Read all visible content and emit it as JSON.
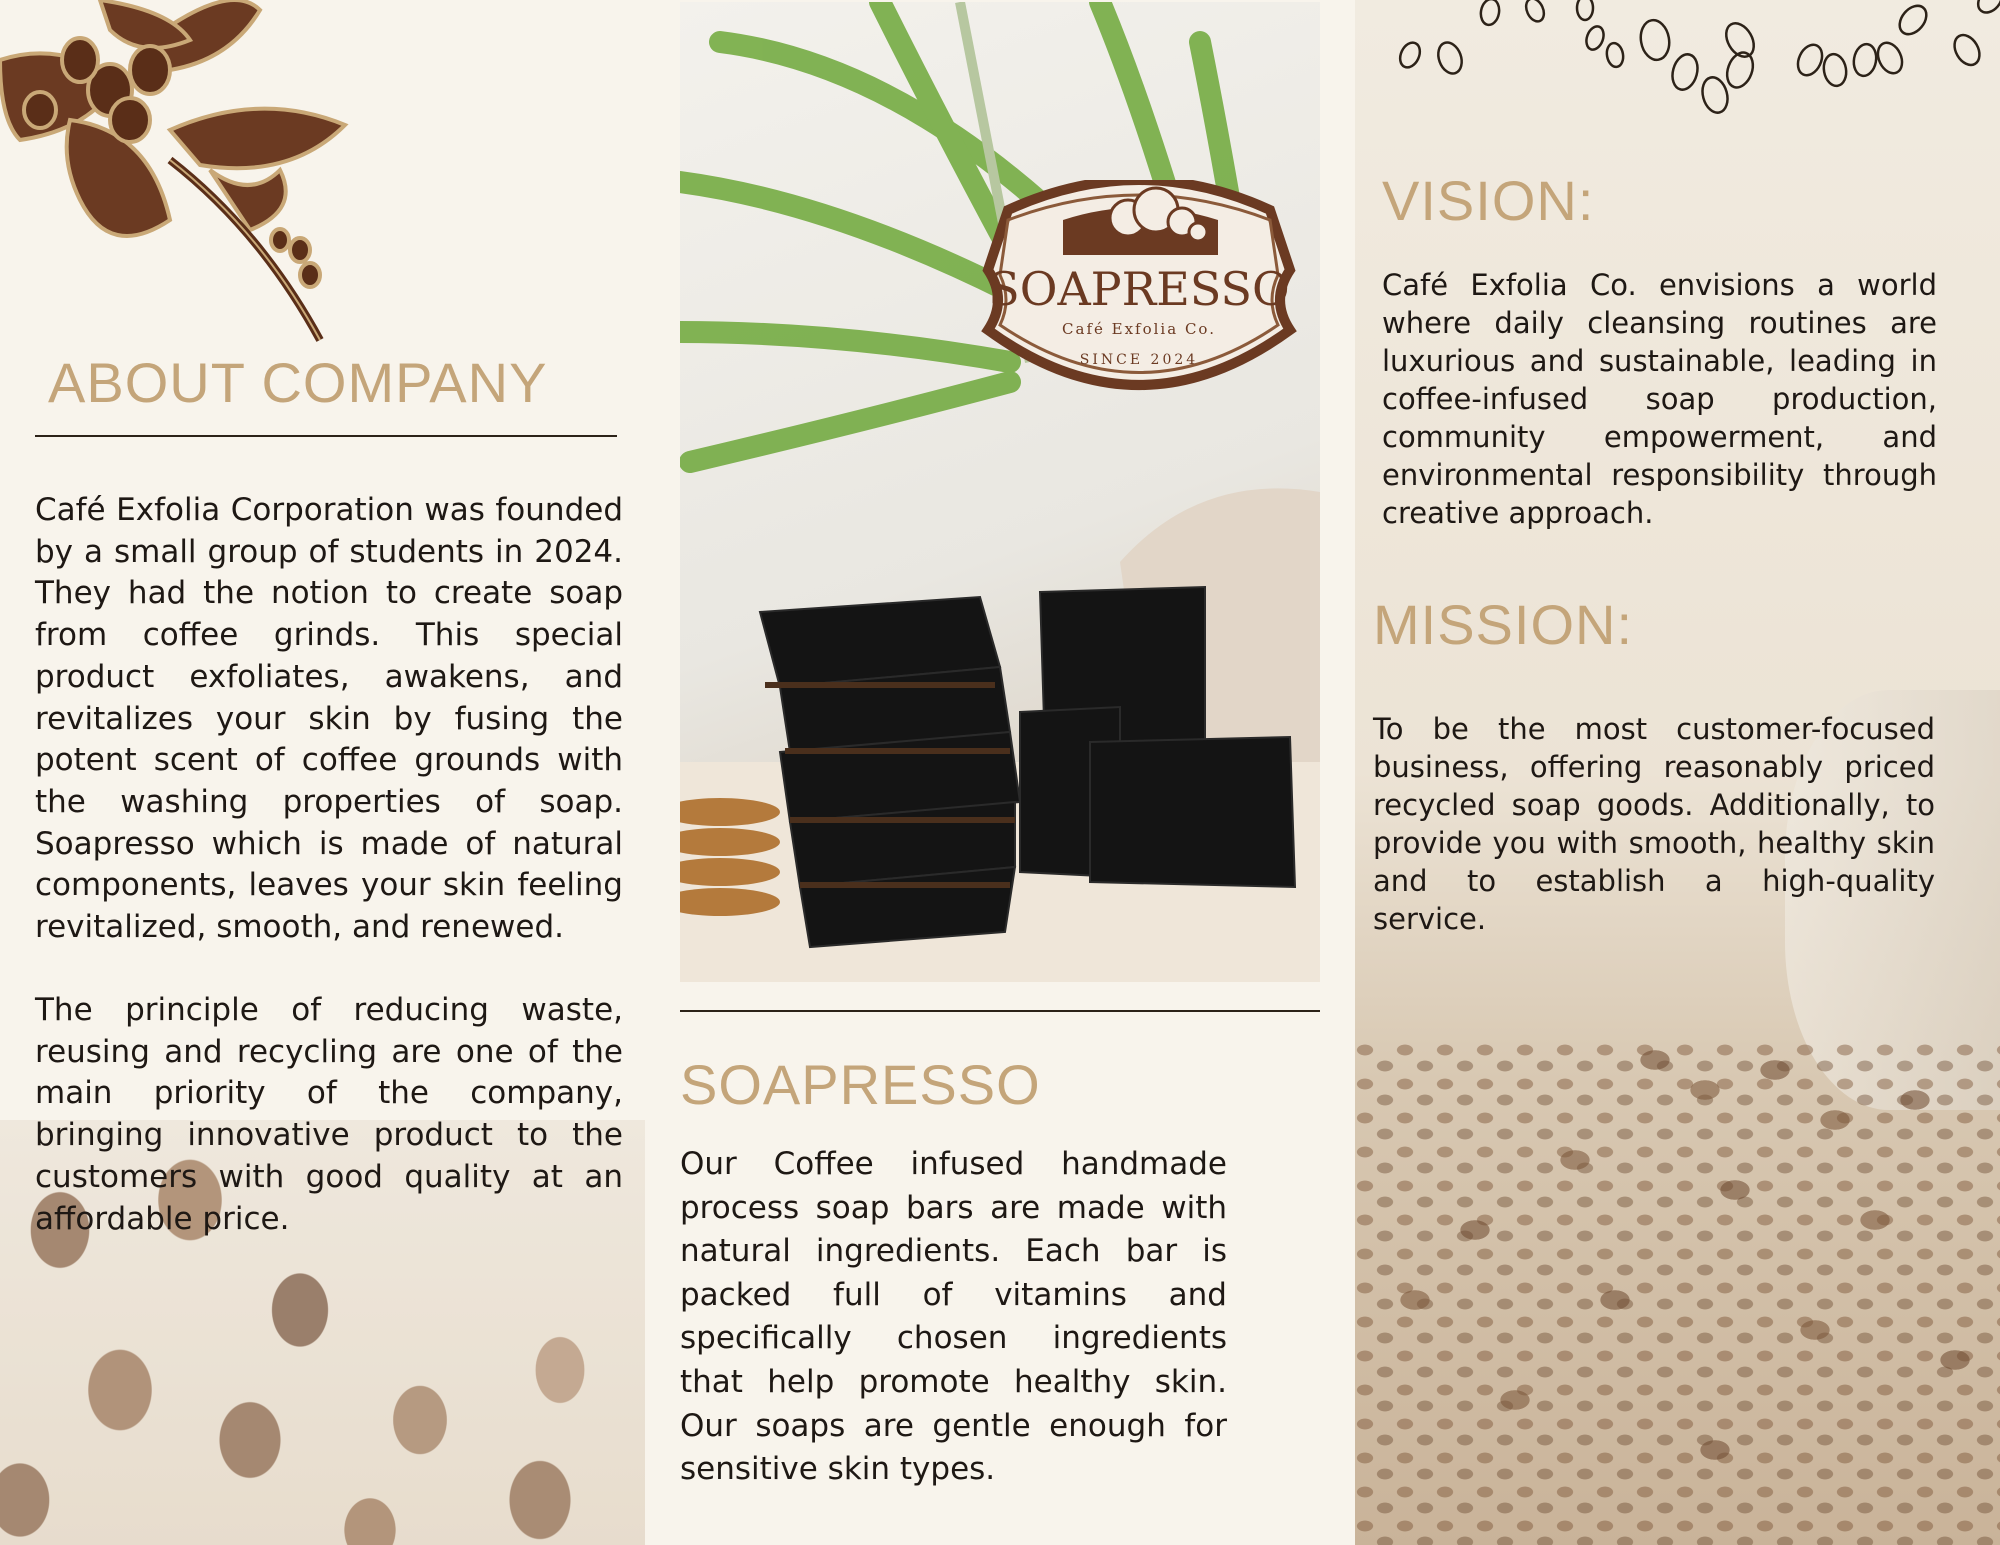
{
  "about": {
    "heading": "ABOUT COMPANY",
    "paragraph1": "Café Exfolia Corporation was founded by a small group of students in 2024. They had the notion to create soap from coffee grinds. This special product exfoliates, awakens, and revitalizes your skin by fusing the potent scent of coffee grounds with the washing properties of soap. Soapresso which is made of natural components, leaves your skin feeling revitalized, smooth, and renewed.",
    "paragraph2": "The principle of reducing waste, reusing and recycling are one of the main priority of the company, bringing innovative product to the customers with good quality at an affordable price."
  },
  "logo": {
    "brand": "SOAPRESSO",
    "subtitle": "Café Exfolia Co.",
    "since": "SINCE 2024"
  },
  "product": {
    "heading": "SOAPRESSO",
    "paragraph": "Our Coffee infused handmade process soap bars are made with natural ingredients. Each bar is packed full of vitamins and specifically chosen ingredients that help promote healthy skin. Our soaps are gentle enough for sensitive skin types."
  },
  "vision": {
    "heading": "VISION:",
    "paragraph": "Café Exfolia Co. envisions a world where daily cleansing routines are luxurious and sustainable, leading in coffee-infused soap production, community empowerment, and environmental responsibility through creative approach."
  },
  "mission": {
    "heading": "MISSION:",
    "paragraph": "To be the most customer-focused business, offering reasonably priced recycled soap goods. Additionally, to provide you with smooth, healthy skin and to establish a high-quality service."
  },
  "colors": {
    "heading": "#c4a57a",
    "brand_brown": "#6b3a22",
    "text": "#1e1814"
  },
  "icons": [
    "coffee-branch-illustration",
    "coffee-bean-outline-icon"
  ]
}
